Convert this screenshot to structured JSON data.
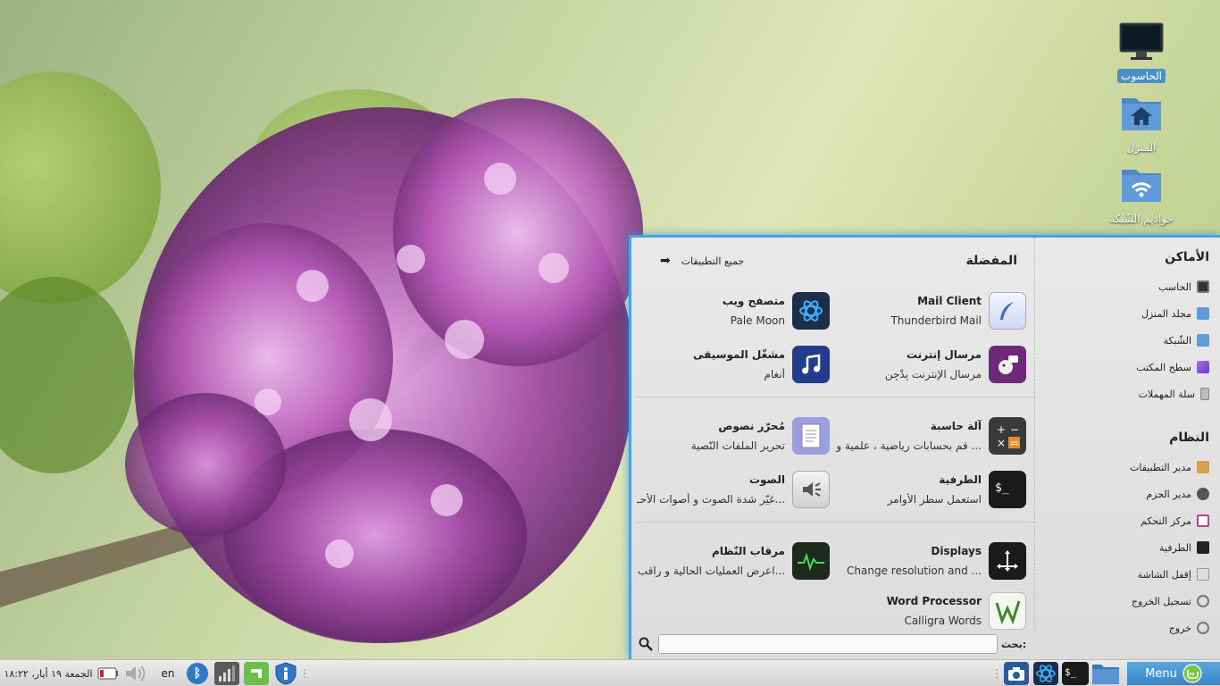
{
  "desktop": {
    "icons": [
      {
        "label": "الحاسوب"
      },
      {
        "label": "المنزل"
      },
      {
        "label": "خواديم الشّبكة"
      }
    ]
  },
  "menu": {
    "places": {
      "title": "الأماكن",
      "items": [
        {
          "label": "الحاسب",
          "icon": "computer-icon"
        },
        {
          "label": "مجلد المنزل",
          "icon": "home-folder-icon"
        },
        {
          "label": "الشّبكة",
          "icon": "network-icon"
        },
        {
          "label": "سطح المكتب",
          "icon": "desktop-icon"
        },
        {
          "label": "سلة المهملات",
          "icon": "trash-icon"
        }
      ]
    },
    "system": {
      "title": "النظام",
      "items": [
        {
          "label": "مدير التطبيقات",
          "icon": "software-manager-icon"
        },
        {
          "label": "مدير الحزم",
          "icon": "package-manager-icon"
        },
        {
          "label": "مركز التحكم",
          "icon": "control-center-icon"
        },
        {
          "label": "الطرفية",
          "icon": "terminal-icon"
        },
        {
          "label": "إقفل الشاشة",
          "icon": "lock-icon"
        },
        {
          "label": "تسجيل الخروج",
          "icon": "logout-icon"
        },
        {
          "label": "خروج",
          "icon": "power-icon"
        }
      ]
    },
    "favorites": {
      "title": "المفضلة",
      "all_apps": "جميع التطبيقات",
      "apps": [
        {
          "name": "Mail Client",
          "desc": "Thunderbird Mail",
          "icon": "mail-icon"
        },
        {
          "name": "متصفح ويب",
          "desc": "Pale Moon",
          "icon": "browser-icon"
        },
        {
          "name": "مرسال إنترنت",
          "desc": "مرسال الإنترنت بِدْجِن",
          "icon": "pidgin-icon"
        },
        {
          "name": "مشغّل الموسيقى",
          "desc": "أنغام",
          "icon": "music-icon"
        },
        {
          "name": "آلة حاسبة",
          "desc": "قم بحسابات رياضية ، علمية و ...",
          "icon": "calculator-icon"
        },
        {
          "name": "مُحرّر نصوص",
          "desc": "تحرير الملفات النّصية",
          "icon": "text-editor-icon"
        },
        {
          "name": "الطرفية",
          "desc": "استعمل سطر الأوامر",
          "icon": "terminal-icon"
        },
        {
          "name": "الصوت",
          "desc": "غيّر شدة الصوت و أصوات الأحـ...",
          "icon": "sound-icon"
        },
        {
          "name": "Displays",
          "desc": "Change resolution and ...",
          "icon": "displays-icon"
        },
        {
          "name": "مرقاب النّظام",
          "desc": "اعرض العمليات الحالية و راقب...",
          "icon": "system-monitor-icon"
        },
        {
          "name": "Word Processor",
          "desc": "Calligra Words",
          "icon": "word-processor-icon"
        }
      ]
    },
    "search": {
      "label": "بحث:",
      "value": "",
      "placeholder": ""
    }
  },
  "panel": {
    "menu_label": "Menu",
    "clock": "الجمعة ١٩ أيار، ١٨:٢٢",
    "keyboard_layout": "en"
  },
  "colors": {
    "accent": "#4aa3df",
    "panel_menu": "#3a86c5"
  }
}
